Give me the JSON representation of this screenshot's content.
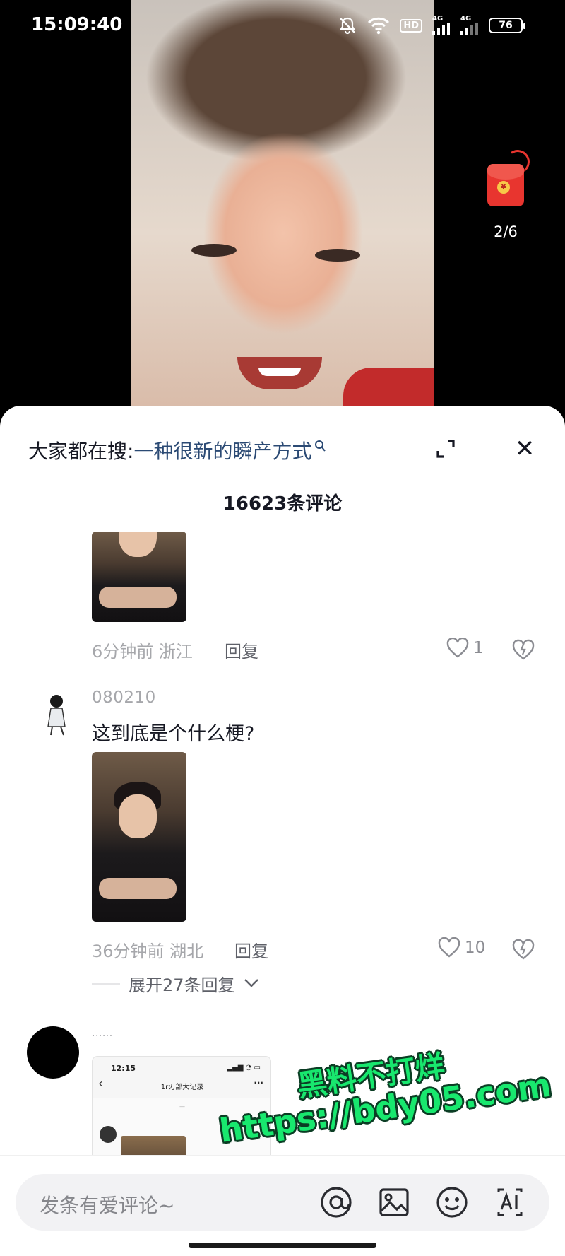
{
  "status_bar": {
    "time": "15:09:40",
    "hd_label": "HD",
    "network_1": "4G",
    "network_2": "4G",
    "battery": "76"
  },
  "red_packet": {
    "progress": "2/6"
  },
  "search": {
    "prefix": "大家都在搜:",
    "term": "一种很新的瞬产方式"
  },
  "comments_header": {
    "count_label": "16623条评论"
  },
  "comments": [
    {
      "time_location": "6分钟前 浙江",
      "reply_label": "回复",
      "likes": "1"
    },
    {
      "username": "080210",
      "text": "这到底是个什么梗?",
      "time_location": "36分钟前 湖北",
      "reply_label": "回复",
      "likes": "10",
      "expand_replies": "展开27条回复"
    },
    {
      "username": "......",
      "embedded_screenshot": {
        "time": "12:15",
        "title": "1r刃部大记录"
      }
    }
  ],
  "input_bar": {
    "placeholder": "发条有爱评论~",
    "icons": [
      "at-icon",
      "image-icon",
      "emoji-icon",
      "ai-icon"
    ]
  },
  "watermark": {
    "line1": "黑料不打烊",
    "line2": "https://bdy05.com",
    "color": "#18e86e"
  }
}
